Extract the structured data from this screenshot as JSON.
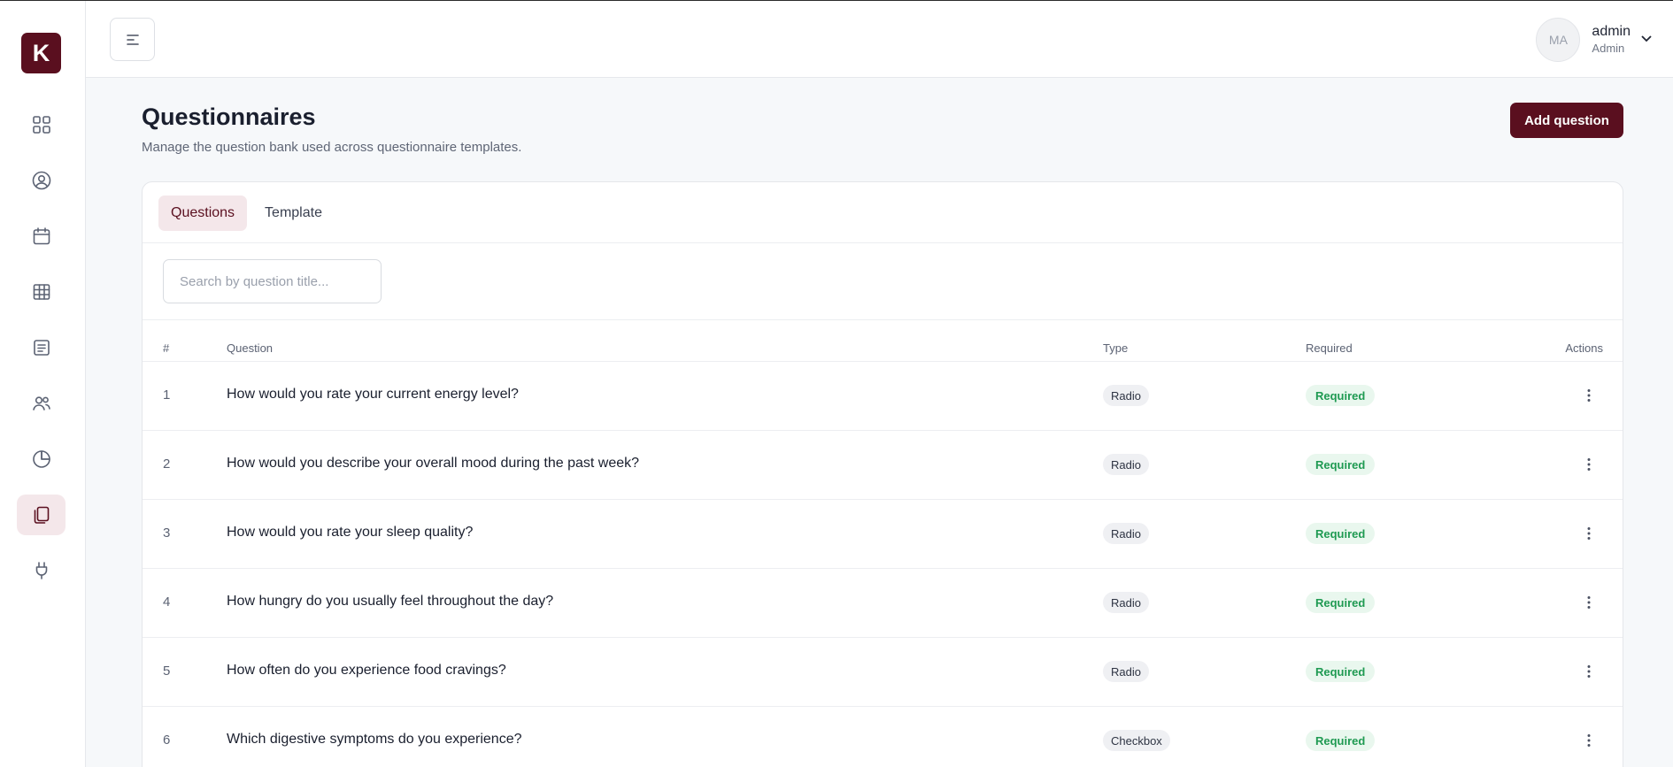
{
  "app": {
    "logo_letter": "K",
    "brand_color": "#5a0f1f"
  },
  "sidebar": {
    "items": [
      {
        "name": "dashboard",
        "icon": "grid-icon",
        "active": false
      },
      {
        "name": "profile",
        "icon": "user-circle-icon",
        "active": false
      },
      {
        "name": "calendar",
        "icon": "calendar-icon",
        "active": false
      },
      {
        "name": "table",
        "icon": "table-icon",
        "active": false
      },
      {
        "name": "document",
        "icon": "document-icon",
        "active": false
      },
      {
        "name": "users",
        "icon": "users-icon",
        "active": false
      },
      {
        "name": "reports",
        "icon": "pie-chart-icon",
        "active": false
      },
      {
        "name": "questionnaires",
        "icon": "copy-icon",
        "active": true
      },
      {
        "name": "integrations",
        "icon": "plug-icon",
        "active": false
      }
    ]
  },
  "header": {
    "user": {
      "initials": "MA",
      "name": "admin",
      "role": "Admin"
    }
  },
  "page": {
    "title": "Questionnaires",
    "subtitle": "Manage the question bank used across questionnaire templates.",
    "add_button": "Add question"
  },
  "tabs": [
    {
      "label": "Questions",
      "active": true
    },
    {
      "label": "Template",
      "active": false
    }
  ],
  "search": {
    "placeholder": "Search by question title...",
    "value": ""
  },
  "table": {
    "columns": {
      "num": "#",
      "question": "Question",
      "type": "Type",
      "required": "Required",
      "actions": "Actions"
    },
    "rows": [
      {
        "num": "1",
        "question": "How would you rate your current energy level?",
        "type": "Radio",
        "required": "Required"
      },
      {
        "num": "2",
        "question": "How would you describe your overall mood during the past week?",
        "type": "Radio",
        "required": "Required"
      },
      {
        "num": "3",
        "question": "How would you rate your sleep quality?",
        "type": "Radio",
        "required": "Required"
      },
      {
        "num": "4",
        "question": "How hungry do you usually feel throughout the day?",
        "type": "Radio",
        "required": "Required"
      },
      {
        "num": "5",
        "question": "How often do you experience food cravings?",
        "type": "Radio",
        "required": "Required"
      },
      {
        "num": "6",
        "question": "Which digestive symptoms do you experience?",
        "type": "Checkbox",
        "required": "Required"
      }
    ]
  }
}
